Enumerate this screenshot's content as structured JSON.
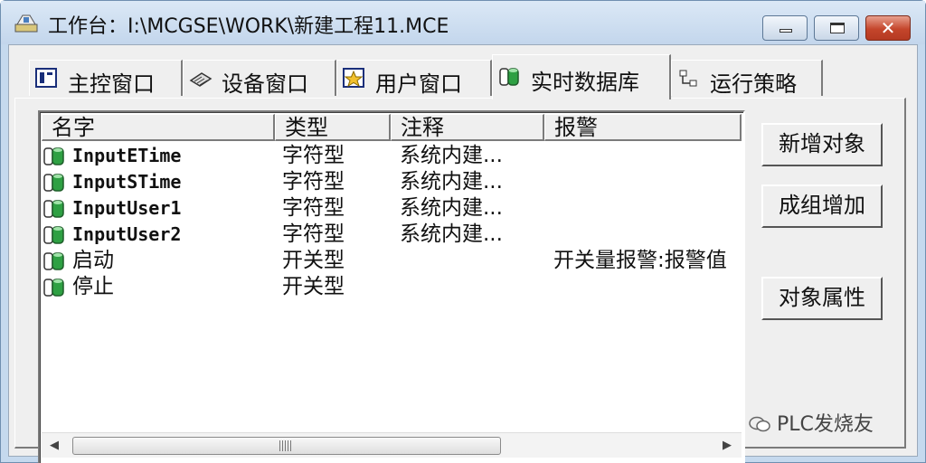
{
  "window": {
    "title": "工作台：I:\\MCGSE\\WORK\\新建工程11.MCE",
    "close_glyph": "✕"
  },
  "tabs": [
    {
      "label": "主控窗口",
      "icon": "main-window-icon"
    },
    {
      "label": "设备窗口",
      "icon": "device-icon"
    },
    {
      "label": "用户窗口",
      "icon": "user-window-icon"
    },
    {
      "label": "实时数据库",
      "icon": "database-icon",
      "active": true
    },
    {
      "label": "运行策略",
      "icon": "strategy-icon"
    }
  ],
  "list": {
    "columns": [
      "名字",
      "类型",
      "注释",
      "报警"
    ],
    "rows": [
      {
        "name": "InputETime",
        "type": "字符型",
        "comment": "系统内建...",
        "alarm": "",
        "mono": true
      },
      {
        "name": "InputSTime",
        "type": "字符型",
        "comment": "系统内建...",
        "alarm": "",
        "mono": true
      },
      {
        "name": "InputUser1",
        "type": "字符型",
        "comment": "系统内建...",
        "alarm": "",
        "mono": true
      },
      {
        "name": "InputUser2",
        "type": "字符型",
        "comment": "系统内建...",
        "alarm": "",
        "mono": true
      },
      {
        "name": "启动",
        "type": "开关型",
        "comment": "",
        "alarm": "开关量报警:报警值",
        "mono": false
      },
      {
        "name": "停止",
        "type": "开关型",
        "comment": "",
        "alarm": "",
        "mono": false
      }
    ],
    "scroll_left": "◀",
    "scroll_right": "▶"
  },
  "buttons": {
    "new_object": "新增对象",
    "group_add": "成组增加",
    "object_props": "对象属性"
  },
  "watermark": "PLC发烧友",
  "colors": {
    "title_bg": "#c5d9ee",
    "close_btn": "#c4452b",
    "db_icon_green": "#2ea043"
  }
}
